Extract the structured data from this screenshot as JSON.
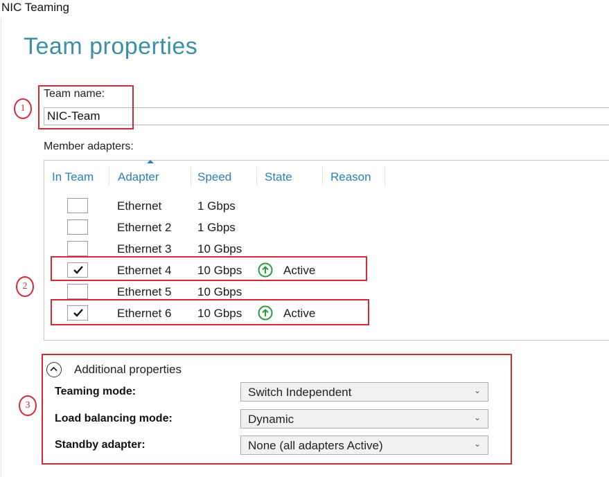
{
  "window": {
    "title": "NIC Teaming"
  },
  "page": {
    "title": "Team properties"
  },
  "team_name": {
    "label": "Team name:",
    "value": "NIC-Team"
  },
  "member_adapters": {
    "label": "Member adapters:",
    "columns": [
      "In Team",
      "Adapter",
      "Speed",
      "State",
      "Reason"
    ],
    "sorted_column": "Adapter",
    "rows": [
      {
        "in_team": false,
        "adapter": "Ethernet",
        "speed": "1 Gbps",
        "state": ""
      },
      {
        "in_team": false,
        "adapter": "Ethernet 2",
        "speed": "1 Gbps",
        "state": ""
      },
      {
        "in_team": false,
        "adapter": "Ethernet 3",
        "speed": "10 Gbps",
        "state": ""
      },
      {
        "in_team": true,
        "adapter": "Ethernet 4",
        "speed": "10 Gbps",
        "state": "Active",
        "state_icon": "arrow-up-circle-icon"
      },
      {
        "in_team": false,
        "adapter": "Ethernet 5",
        "speed": "10 Gbps",
        "state": ""
      },
      {
        "in_team": true,
        "adapter": "Ethernet 6",
        "speed": "10 Gbps",
        "state": "Active",
        "state_icon": "arrow-up-circle-icon"
      }
    ]
  },
  "additional_properties": {
    "label": "Additional properties",
    "expanded": true,
    "teaming_mode": {
      "label": "Teaming mode:",
      "value": "Switch Independent"
    },
    "load_balancing_mode": {
      "label": "Load balancing mode:",
      "value": "Dynamic"
    },
    "standby_adapter": {
      "label": "Standby adapter:",
      "value": "None (all adapters Active)"
    }
  },
  "annotations": {
    "marker_1": "1",
    "marker_2": "2",
    "marker_3": "3",
    "color": "#d42a35"
  },
  "colors": {
    "title": "#3b8fa6",
    "column_header": "#2d7fb6",
    "status_active": "#2e9a3e"
  }
}
